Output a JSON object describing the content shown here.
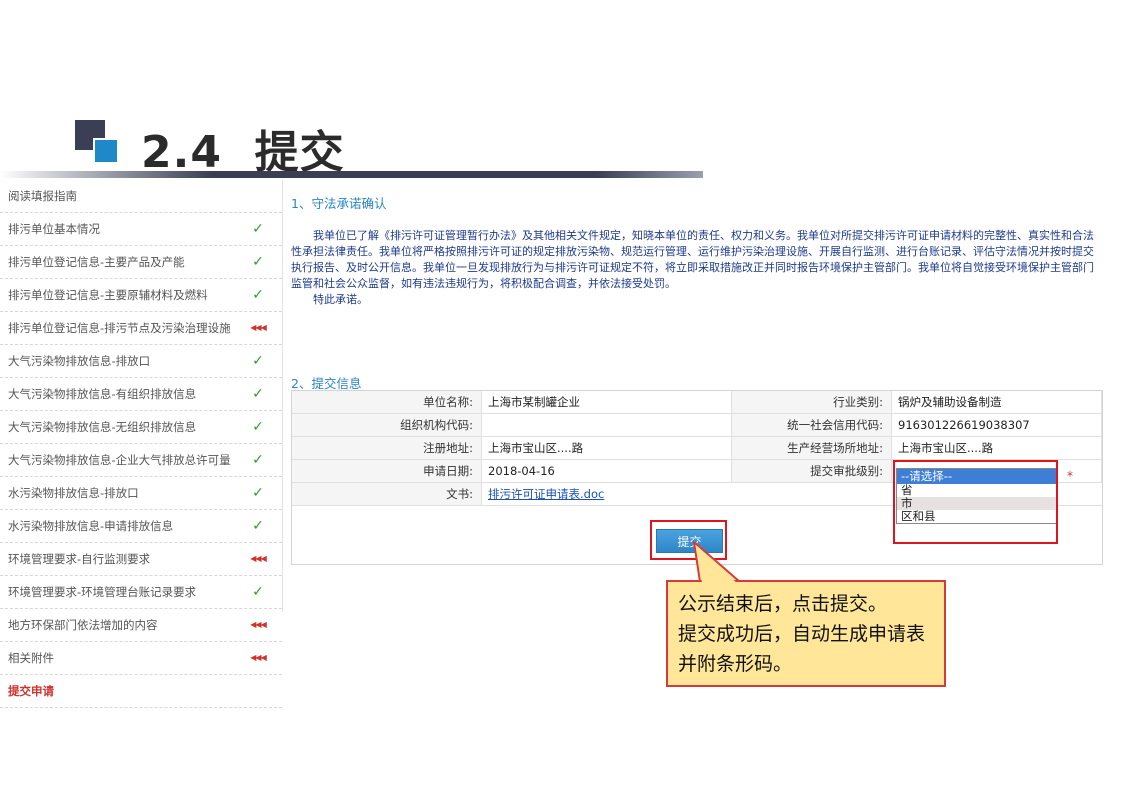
{
  "slide": {
    "number": "2.4",
    "title": "提交"
  },
  "sidebar": {
    "items": [
      {
        "label": "阅读填报指南",
        "status": "none"
      },
      {
        "label": "排污单位基本情况",
        "status": "done"
      },
      {
        "label": "排污单位登记信息-主要产品及产能",
        "status": "done"
      },
      {
        "label": "排污单位登记信息-主要原辅材料及燃料",
        "status": "done"
      },
      {
        "label": "排污单位登记信息-排污节点及污染治理设施",
        "status": "pending"
      },
      {
        "label": "大气污染物排放信息-排放口",
        "status": "done"
      },
      {
        "label": "大气污染物排放信息-有组织排放信息",
        "status": "done"
      },
      {
        "label": "大气污染物排放信息-无组织排放信息",
        "status": "done"
      },
      {
        "label": "大气污染物排放信息-企业大气排放总许可量",
        "status": "done"
      },
      {
        "label": "水污染物排放信息-排放口",
        "status": "done"
      },
      {
        "label": "水污染物排放信息-申请排放信息",
        "status": "done"
      },
      {
        "label": "环境管理要求-自行监测要求",
        "status": "pending"
      },
      {
        "label": "环境管理要求-环境管理台账记录要求",
        "status": "done"
      },
      {
        "label": "地方环保部门依法增加的内容",
        "status": "pending"
      },
      {
        "label": "相关附件",
        "status": "pending"
      },
      {
        "label": "提交申请",
        "status": "active"
      }
    ],
    "check_glyph": "✓",
    "pending_glyph": "◀◀◀"
  },
  "section1": {
    "heading": "1、守法承诺确认",
    "paragraph": "我单位已了解《排污许可证管理暂行办法》及其他相关文件规定，知晓本单位的责任、权力和义务。我单位对所提交排污许可证申请材料的完整性、真实性和合法性承担法律责任。我单位将严格按照排污许可证的规定排放污染物、规范运行管理、运行维护污染治理设施、开展自行监测、进行台账记录、评估守法情况并按时提交执行报告、及时公开信息。我单位一旦发现排放行为与排污许可证规定不符，将立即采取措施改正并同时报告环境保护主管部门。我单位将自觉接受环境保护主管部门监管和社会公众监督，如有违法违规行为，将积极配合调查，并依法接受处罚。",
    "closing": "特此承诺。"
  },
  "section2": {
    "heading": "2、提交信息",
    "unit_name_label": "单位名称:",
    "unit_name": "上海市某制罐企业",
    "industry_label": "行业类别:",
    "industry": "锅炉及辅助设备制造",
    "org_code_label": "组织机构代码:",
    "org_code": "",
    "credit_code_label": "统一社会信用代码:",
    "credit_code": "916301226619038307",
    "reg_address_label": "注册地址:",
    "reg_address": "上海市宝山区....路",
    "prod_address_label": "生产经营场所地址:",
    "prod_address": "上海市宝山区....路",
    "apply_date_label": "申请日期:",
    "apply_date": "2018-04-16",
    "approval_level_label": "提交审批级别:",
    "approval_options": [
      "--请选择--",
      "省",
      "市",
      "区和县"
    ],
    "required_mark": "*",
    "document_label": "文书:",
    "document_link": "排污许可证申请表.doc",
    "submit_label": "提交"
  },
  "callout": {
    "line1": "公示结束后，点击提交。",
    "line2": "提交成功后，自动生成申请表并附条形码。"
  },
  "colors": {
    "accent_blue": "#2a86c7",
    "check_green": "#2e9d2e",
    "alert_red": "#e0141e",
    "callout_fill": "#ffe699",
    "title_dark": "#3a3f55"
  }
}
